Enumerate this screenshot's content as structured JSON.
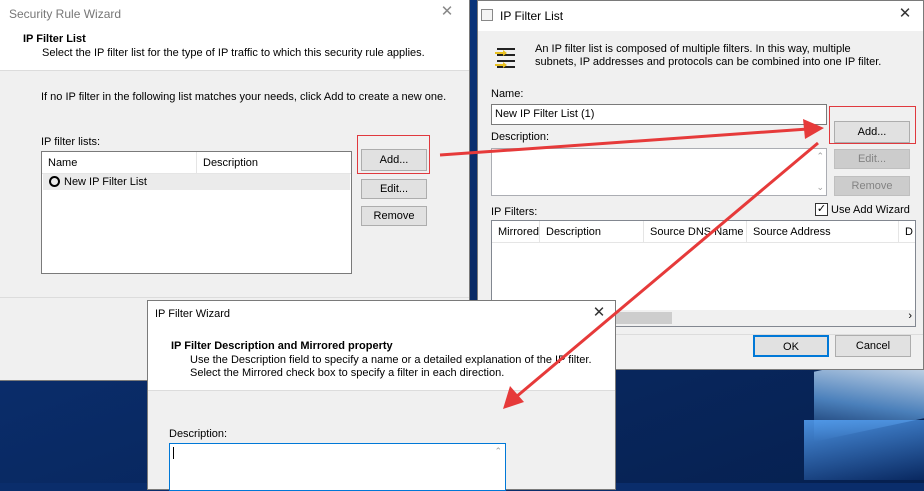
{
  "colors": {
    "arrow": "#e63a3a",
    "frame": "#e0393e",
    "desktop": "#0a2d6b"
  },
  "security_wizard": {
    "title": "Security Rule Wizard",
    "heading": "IP Filter List",
    "subheading": "Select the IP filter list for the type of IP traffic to which this security rule applies.",
    "instruction": "If no IP filter in the following list matches your needs, click Add to create a new one.",
    "lists_label": "IP filter lists:",
    "columns": [
      "Name",
      "Description"
    ],
    "rows": [
      {
        "name": "New IP Filter List",
        "description": ""
      }
    ],
    "buttons": {
      "add": "Add...",
      "edit": "Edit...",
      "remove": "Remove"
    }
  },
  "ip_filter_list": {
    "title": "IP Filter List",
    "info": "An IP filter list is composed of multiple filters. In this way, multiple subnets, IP addresses and protocols can be combined into one IP filter.",
    "name_label": "Name:",
    "name_value": "New IP Filter List (1)",
    "description_label": "Description:",
    "filters_label": "IP Filters:",
    "use_add_wizard": "Use Add Wizard",
    "columns": [
      "Mirrored",
      "Description",
      "Source DNS Name",
      "Source Address",
      "D"
    ],
    "buttons": {
      "add": "Add...",
      "edit": "Edit...",
      "remove": "Remove",
      "ok": "OK",
      "cancel": "Cancel"
    }
  },
  "filter_wizard": {
    "title": "IP Filter Wizard",
    "heading": "IP Filter Description and Mirrored property",
    "subtext_line1": "Use the Description field to specify a name or a detailed explanation of the IP filter.",
    "subtext_line2": "Select the Mirrored check box to specify a filter in each direction.",
    "description_label": "Description:"
  }
}
